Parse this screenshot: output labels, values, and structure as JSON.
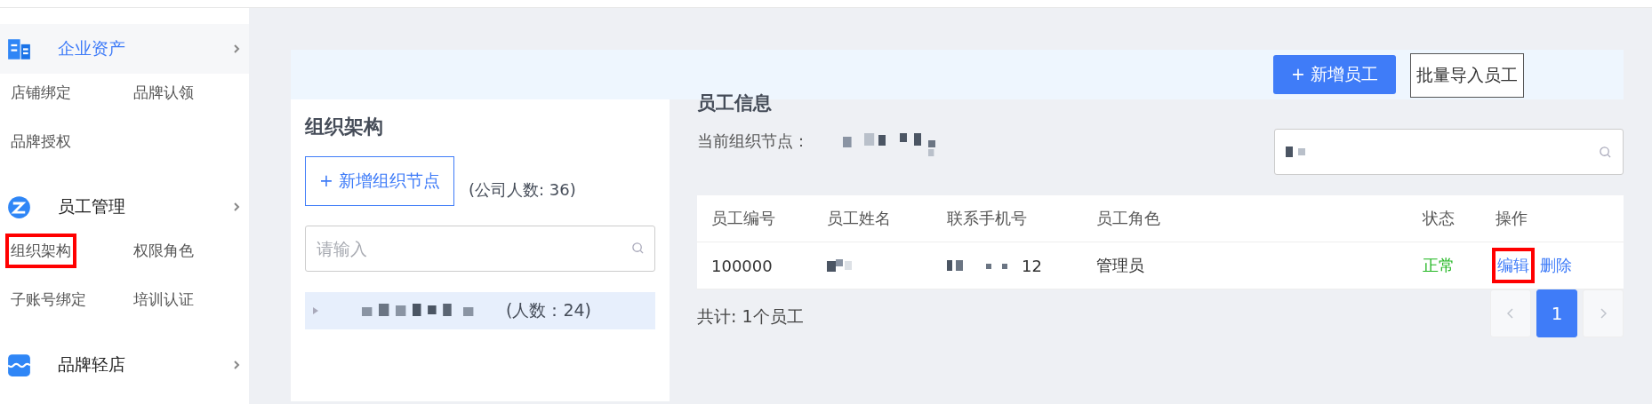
{
  "sidebar": {
    "groups": [
      {
        "title": "企业资产",
        "active": true,
        "items": [
          {
            "label": "店铺绑定",
            "highlighted": false
          },
          {
            "label": "品牌认领",
            "highlighted": false
          },
          {
            "label": "品牌授权",
            "highlighted": false
          }
        ]
      },
      {
        "title": "员工管理",
        "active": false,
        "items": [
          {
            "label": "组织架构",
            "highlighted": true
          },
          {
            "label": "权限角色",
            "highlighted": false
          },
          {
            "label": "子账号绑定",
            "highlighted": false
          },
          {
            "label": "培训认证",
            "highlighted": false
          }
        ]
      },
      {
        "title": "品牌轻店",
        "active": false
      }
    ]
  },
  "toolbar": {
    "buttons": [
      {
        "label": "+ 新增员工",
        "kind": "primary"
      },
      {
        "label": "批量导入员工",
        "kind": "outline"
      }
    ]
  },
  "org_panel": {
    "title": "组织架构",
    "add_button": "+ 新增组织节点",
    "company_count": "(公司人数: 36)",
    "search": {
      "placeholder": "请输入"
    },
    "tree": [
      {
        "count": "(人数：24)",
        "selected": true,
        "expanded": false
      }
    ]
  },
  "employee_panel": {
    "title": "员工信息",
    "current_node_label": "当前组织节点：",
    "table": {
      "columns": [
        "员工编号",
        "员工姓名",
        "联系手机号",
        "员工角色",
        "状态",
        "操作"
      ],
      "rows": [
        {
          "id": "100000",
          "phone_end": "12",
          "role": "管理员",
          "status": "正常",
          "status_ok": true,
          "actions": [
            {
              "label": "编辑",
              "highlighted": true
            },
            {
              "label": "删除",
              "highlighted": false
            }
          ]
        }
      ]
    },
    "total": "共计: 1个员工",
    "pagination": {
      "pages": [
        {
          "label": "1",
          "selected": true
        }
      ]
    }
  }
}
